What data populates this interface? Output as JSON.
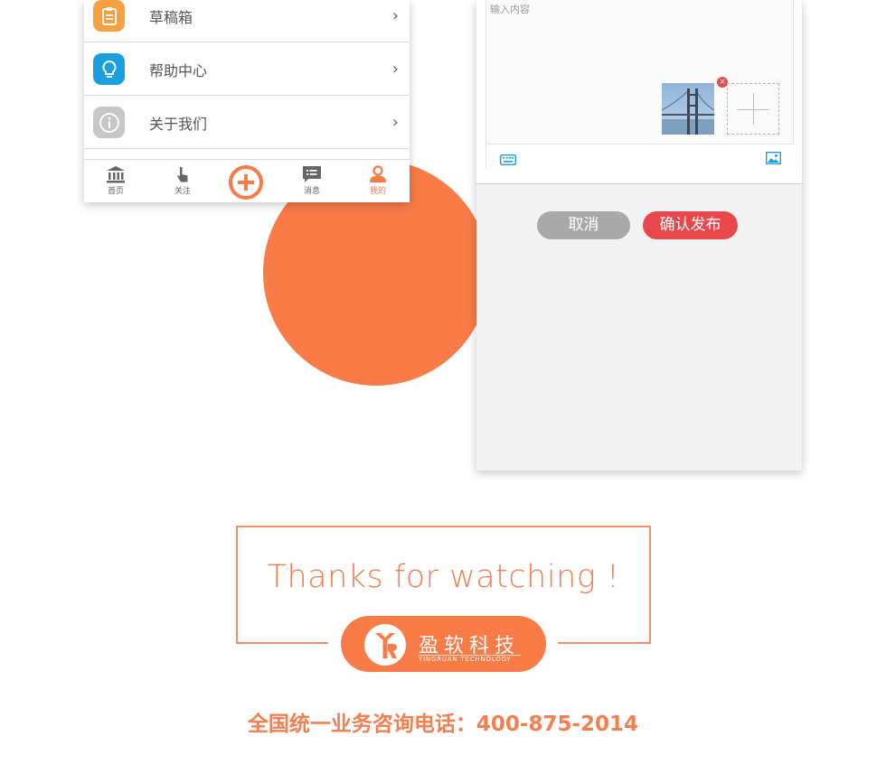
{
  "colors": {
    "brand_orange": "#f97b47",
    "red": "#e8484c",
    "gray_button": "#a9a9a9"
  },
  "menu": {
    "items": [
      {
        "label": "草稿箱",
        "icon": "clipboard-icon",
        "icon_color": "#f7a041"
      },
      {
        "label": "帮助中心",
        "icon": "lightbulb-icon",
        "icon_color": "#1aa0dd"
      },
      {
        "label": "关于我们",
        "icon": "info-icon",
        "icon_color": "#c7c7c7"
      }
    ],
    "chevron": "›"
  },
  "tabbar": {
    "tabs": [
      {
        "label": "首页",
        "icon": "bank-icon"
      },
      {
        "label": "关注",
        "icon": "tap-hand-icon"
      },
      {
        "label": "消息",
        "icon": "message-icon"
      },
      {
        "label": "我的",
        "icon": "user-icon"
      }
    ],
    "center_icon": "add-circle-icon"
  },
  "compose": {
    "placeholder": "输入内容",
    "remove_glyph": "×",
    "cancel_label": "取消",
    "publish_label": "确认发布"
  },
  "thanks": {
    "text": "Thanks for watching !",
    "company_name": "盈软科技",
    "company_sub": "YINGRUAN TECHNOLOGY"
  },
  "hotline": "全国统一业务咨询电话：400-875-2014"
}
